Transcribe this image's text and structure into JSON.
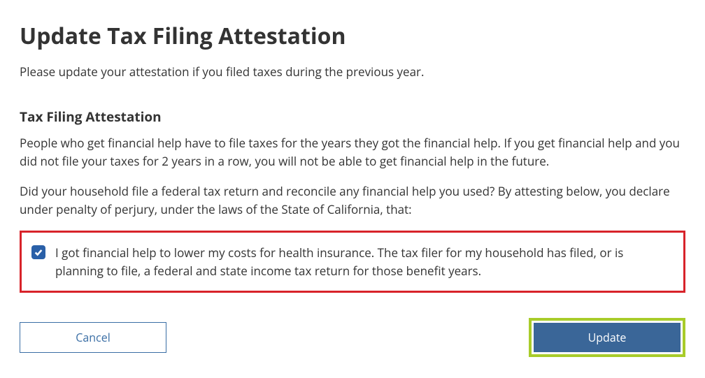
{
  "page": {
    "title": "Update Tax Filing Attestation",
    "intro": "Please update your attestation if you filed taxes during the previous year."
  },
  "section": {
    "title": "Tax Filing Attestation",
    "paragraph1": "People who get financial help have to file taxes for the years they got the financial help. If you get financial help and you did not file your taxes for 2 years in a row, you will not be able to get financial help in the future.",
    "paragraph2": "Did your household file a federal tax return and reconcile any financial help you used? By attesting below, you declare under penalty of perjury, under the laws of the State of California, that:"
  },
  "attestation": {
    "checked": true,
    "label": "I got financial help to lower my costs for health insurance. The tax filer for my household has filed, or is planning to file, a federal and state income tax return for those benefit years."
  },
  "buttons": {
    "cancel": "Cancel",
    "update": "Update"
  },
  "highlight_colors": {
    "attestation_border": "#d8232a",
    "update_border": "#a8cc2a"
  }
}
